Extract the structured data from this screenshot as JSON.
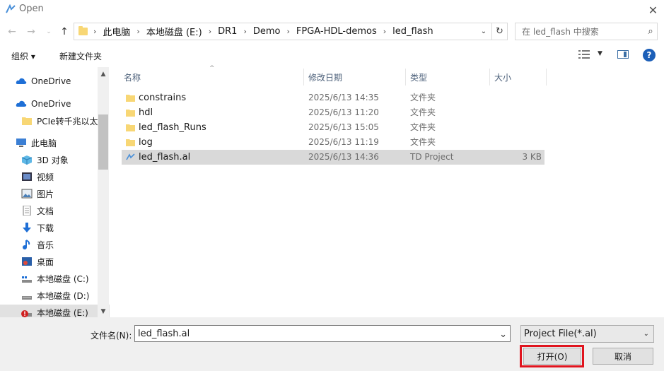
{
  "window": {
    "title": "Open"
  },
  "address": {
    "crumbs": [
      "此电脑",
      "本地磁盘 (E:)",
      "DR1",
      "Demo",
      "FPGA-HDL-demos",
      "led_flash"
    ]
  },
  "search": {
    "placeholder": "在 led_flash 中搜索"
  },
  "toolbar": {
    "organize": "组织 ▾",
    "new_folder": "新建文件夹"
  },
  "nav": {
    "items": [
      {
        "label": "OneDrive",
        "icon": "cloud-icon"
      },
      {
        "label": "OneDrive",
        "icon": "cloud-icon"
      },
      {
        "label": "PCIe转千兆以太",
        "icon": "folder-icon"
      },
      {
        "label": "此电脑",
        "icon": "computer-icon"
      },
      {
        "label": "3D 对象",
        "icon": "cube-icon"
      },
      {
        "label": "视频",
        "icon": "video-icon"
      },
      {
        "label": "图片",
        "icon": "picture-icon"
      },
      {
        "label": "文档",
        "icon": "document-icon"
      },
      {
        "label": "下载",
        "icon": "download-icon"
      },
      {
        "label": "音乐",
        "icon": "music-icon"
      },
      {
        "label": "桌面",
        "icon": "desktop-icon"
      },
      {
        "label": "本地磁盘 (C:)",
        "icon": "drive-icon"
      },
      {
        "label": "本地磁盘 (D:)",
        "icon": "drive-icon"
      },
      {
        "label": "本地磁盘 (E:)",
        "icon": "drive-warning-icon"
      }
    ]
  },
  "columns": {
    "name": "名称",
    "date": "修改日期",
    "type": "类型",
    "size": "大小"
  },
  "files": [
    {
      "name": "constrains",
      "date": "2025/6/13 14:35",
      "type": "文件夹",
      "size": ""
    },
    {
      "name": "hdl",
      "date": "2025/6/13 11:20",
      "type": "文件夹",
      "size": ""
    },
    {
      "name": "led_flash_Runs",
      "date": "2025/6/13 15:05",
      "type": "文件夹",
      "size": ""
    },
    {
      "name": "log",
      "date": "2025/6/13 11:19",
      "type": "文件夹",
      "size": ""
    },
    {
      "name": "led_flash.al",
      "date": "2025/6/13 14:36",
      "type": "TD Project",
      "size": "3 KB"
    }
  ],
  "bottom": {
    "filename_label": "文件名(N):",
    "filename_value": "led_flash.al",
    "filter_value": "Project File(*.al)",
    "open_label": "打开(O)",
    "cancel_label": "取消"
  },
  "colors": {
    "accent": "#1c5fb8",
    "folder": "#f8d775",
    "highlight": "#e0141e"
  }
}
